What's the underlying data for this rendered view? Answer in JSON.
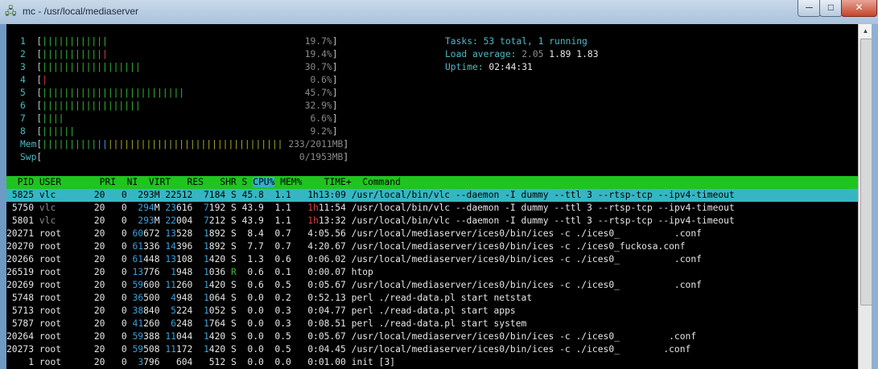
{
  "window": {
    "title": "mc - /usr/local/mediaserver",
    "minimize_label": "─",
    "maximize_label": "□",
    "close_label": "✕"
  },
  "meters": {
    "cpus": [
      {
        "num": "1",
        "bars": "||||||||||||",
        "red": "",
        "pct": "19.7%"
      },
      {
        "num": "2",
        "bars": "|||||||||||",
        "red": "|",
        "pct": "19.4%"
      },
      {
        "num": "3",
        "bars": "||||||||||||||||||",
        "red": "",
        "pct": "30.7%"
      },
      {
        "num": "4",
        "bars": "",
        "red": "|",
        "pct": "0.6%"
      },
      {
        "num": "5",
        "bars": "||||||||||||||||||||||||||",
        "red": "",
        "pct": "45.7%"
      },
      {
        "num": "6",
        "bars": "||||||||||||||||||",
        "red": "",
        "pct": "32.9%"
      },
      {
        "num": "7",
        "bars": "||||",
        "red": "",
        "pct": "6.6%"
      },
      {
        "num": "8",
        "bars": "||||||",
        "red": "",
        "pct": "9.2%"
      }
    ],
    "mem": {
      "label": "Mem",
      "green": "||||||||||",
      "blue": "||",
      "yellow": "||||||||||||||||||||||||||||||||",
      "value": "233/2011MB"
    },
    "swp": {
      "label": "Swp",
      "value": "0/1953MB"
    }
  },
  "summary": {
    "tasks_label": "Tasks:",
    "tasks_value": "53 total, 1 running",
    "load_label": "Load average:",
    "load_1": "2.05",
    "load_5": "1.89",
    "load_15": "1.83",
    "uptime_label": "Uptime:",
    "uptime_value": "02:44:31"
  },
  "header": {
    "pid": "PID",
    "user": "USER",
    "pri": "PRI",
    "ni": "NI",
    "virt": "VIRT",
    "res": "RES",
    "shr": "SHR",
    "s": "S",
    "cpu": "CPU%",
    "mem": "MEM%",
    "time": "TIME+",
    "command": "Command"
  },
  "processes": [
    {
      "pid": "5825",
      "user": "vlc",
      "pri": "20",
      "ni": "0",
      "virt_a": "293",
      "virt_b": "M",
      "res_a": "22",
      "res_b": "512",
      "shr_a": "7",
      "shr_b": "184",
      "s": "S",
      "cpu": "45.8",
      "mem": "1.1",
      "time_h": "1h",
      "time_r": "13:09",
      "command": "/usr/local/bin/vlc --daemon -I dummy --ttl 3 --rtsp-tcp --ipv4-timeout"
    },
    {
      "pid": "5750",
      "user": "vlc",
      "pri": "20",
      "ni": "0",
      "virt_a": "294",
      "virt_b": "M",
      "res_a": "23",
      "res_b": "616",
      "shr_a": "7",
      "shr_b": "192",
      "s": "S",
      "cpu": "43.9",
      "mem": "1.1",
      "time_h": "1h",
      "time_r": "11:54",
      "command": "/usr/local/bin/vlc --daemon -I dummy --ttl 3 --rtsp-tcp --ipv4-timeout"
    },
    {
      "pid": "5801",
      "user": "vlc",
      "pri": "20",
      "ni": "0",
      "virt_a": "293",
      "virt_b": "M",
      "res_a": "22",
      "res_b": "004",
      "shr_a": "7",
      "shr_b": "212",
      "s": "S",
      "cpu": "43.9",
      "mem": "1.1",
      "time_h": "1h",
      "time_r": "13:32",
      "command": "/usr/local/bin/vlc --daemon -I dummy --ttl 3 --rtsp-tcp --ipv4-timeout"
    },
    {
      "pid": "20271",
      "user": "root",
      "pri": "20",
      "ni": "0",
      "virt_a": "60",
      "virt_b": "672",
      "res_a": "13",
      "res_b": "528",
      "shr_a": "1",
      "shr_b": "892",
      "s": "S",
      "cpu": "8.4",
      "mem": "0.7",
      "time_h": "",
      "time_r": "4:05.56",
      "command": "/usr/local/mediaserver/ices0/bin/ices -c ./ices0_          .conf"
    },
    {
      "pid": "20270",
      "user": "root",
      "pri": "20",
      "ni": "0",
      "virt_a": "61",
      "virt_b": "336",
      "res_a": "14",
      "res_b": "396",
      "shr_a": "1",
      "shr_b": "892",
      "s": "S",
      "cpu": "7.7",
      "mem": "0.7",
      "time_h": "",
      "time_r": "4:20.67",
      "command": "/usr/local/mediaserver/ices0/bin/ices -c ./ices0_fuckosa.conf"
    },
    {
      "pid": "20266",
      "user": "root",
      "pri": "20",
      "ni": "0",
      "virt_a": "61",
      "virt_b": "448",
      "res_a": "13",
      "res_b": "108",
      "shr_a": "1",
      "shr_b": "420",
      "s": "S",
      "cpu": "1.3",
      "mem": "0.6",
      "time_h": "",
      "time_r": "0:06.02",
      "command": "/usr/local/mediaserver/ices0/bin/ices -c ./ices0_          .conf"
    },
    {
      "pid": "26519",
      "user": "root",
      "pri": "20",
      "ni": "0",
      "virt_a": "13",
      "virt_b": "776",
      "res_a": "1",
      "res_b": "948",
      "shr_a": "1",
      "shr_b": "036",
      "s": "R",
      "cpu": "0.6",
      "mem": "0.1",
      "time_h": "",
      "time_r": "0:00.07",
      "command": "htop"
    },
    {
      "pid": "20269",
      "user": "root",
      "pri": "20",
      "ni": "0",
      "virt_a": "59",
      "virt_b": "600",
      "res_a": "11",
      "res_b": "260",
      "shr_a": "1",
      "shr_b": "420",
      "s": "S",
      "cpu": "0.6",
      "mem": "0.5",
      "time_h": "",
      "time_r": "0:05.67",
      "command": "/usr/local/mediaserver/ices0/bin/ices -c ./ices0_          .conf"
    },
    {
      "pid": "5748",
      "user": "root",
      "pri": "20",
      "ni": "0",
      "virt_a": "36",
      "virt_b": "500",
      "res_a": "4",
      "res_b": "948",
      "shr_a": "1",
      "shr_b": "064",
      "s": "S",
      "cpu": "0.0",
      "mem": "0.2",
      "time_h": "",
      "time_r": "0:52.13",
      "command": "perl ./read-data.pl start netstat"
    },
    {
      "pid": "5713",
      "user": "root",
      "pri": "20",
      "ni": "0",
      "virt_a": "38",
      "virt_b": "840",
      "res_a": "5",
      "res_b": "224",
      "shr_a": "1",
      "shr_b": "052",
      "s": "S",
      "cpu": "0.0",
      "mem": "0.3",
      "time_h": "",
      "time_r": "0:04.77",
      "command": "perl ./read-data.pl start apps"
    },
    {
      "pid": "5787",
      "user": "root",
      "pri": "20",
      "ni": "0",
      "virt_a": "41",
      "virt_b": "260",
      "res_a": "6",
      "res_b": "248",
      "shr_a": "1",
      "shr_b": "764",
      "s": "S",
      "cpu": "0.0",
      "mem": "0.3",
      "time_h": "",
      "time_r": "0:08.51",
      "command": "perl ./read-data.pl start system"
    },
    {
      "pid": "20264",
      "user": "root",
      "pri": "20",
      "ni": "0",
      "virt_a": "59",
      "virt_b": "388",
      "res_a": "11",
      "res_b": "044",
      "shr_a": "1",
      "shr_b": "420",
      "s": "S",
      "cpu": "0.0",
      "mem": "0.5",
      "time_h": "",
      "time_r": "0:05.67",
      "command": "/usr/local/mediaserver/ices0/bin/ices -c ./ices0_         .conf"
    },
    {
      "pid": "20273",
      "user": "root",
      "pri": "20",
      "ni": "0",
      "virt_a": "59",
      "virt_b": "508",
      "res_a": "11",
      "res_b": "172",
      "shr_a": "1",
      "shr_b": "420",
      "s": "S",
      "cpu": "0.0",
      "mem": "0.5",
      "time_h": "",
      "time_r": "0:04.45",
      "command": "/usr/local/mediaserver/ices0/bin/ices -c ./ices0_        .conf"
    },
    {
      "pid": "1",
      "user": "root",
      "pri": "20",
      "ni": "0",
      "virt_a": "3",
      "virt_b": "796",
      "res_a": "",
      "res_b": "604",
      "shr_a": "",
      "shr_b": "512",
      "s": "S",
      "cpu": "0.0",
      "mem": "0.0",
      "time_h": "",
      "time_r": "0:01.00",
      "command": "init [3]"
    }
  ]
}
